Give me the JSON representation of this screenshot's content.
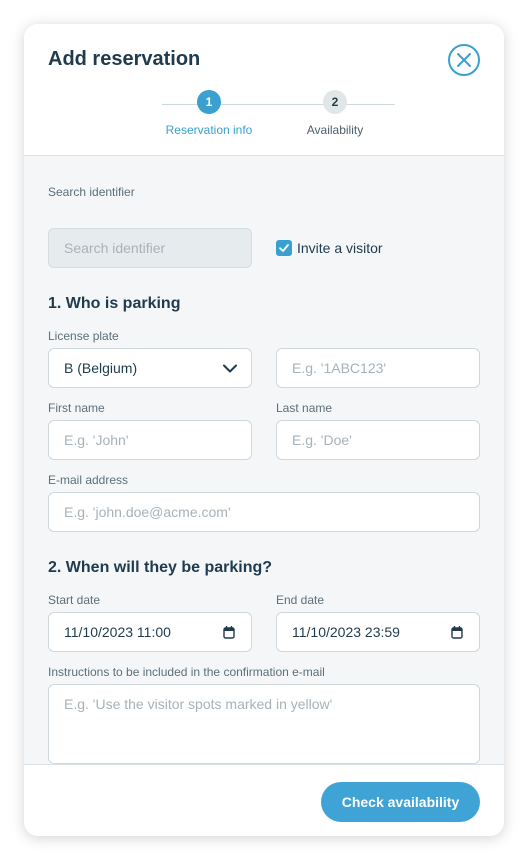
{
  "modal": {
    "title": "Add reservation"
  },
  "stepper": {
    "steps": [
      {
        "number": "1",
        "label": "Reservation info"
      },
      {
        "number": "2",
        "label": "Availability"
      }
    ]
  },
  "form": {
    "search_identifier": {
      "label": "Search identifier",
      "placeholder": "Search identifier",
      "value": ""
    },
    "invite_visitor": {
      "label": "Invite a visitor",
      "checked": true
    },
    "section_1_title": "1. Who is parking",
    "license_plate": {
      "label": "License plate",
      "country_selected": "B (Belgium)",
      "placeholder": "E.g. '1ABC123'"
    },
    "first_name": {
      "label": "First name",
      "placeholder": "E.g. 'John'"
    },
    "last_name": {
      "label": "Last name",
      "placeholder": "E.g. 'Doe'"
    },
    "email": {
      "label": "E-mail address",
      "placeholder": "E.g. 'john.doe@acme.com'"
    },
    "section_2_title": "2. When will they be parking?",
    "start_date": {
      "label": "Start date",
      "value": "11/10/2023 11:00"
    },
    "end_date": {
      "label": "End date",
      "value": "11/10/2023 23:59"
    },
    "instructions": {
      "label": "Instructions to be included in the confirmation e-mail",
      "placeholder": "E.g. 'Use the visitor spots marked in yellow'"
    }
  },
  "footer": {
    "check_label": "Check availability"
  },
  "colors": {
    "accent": "#3aa0cf",
    "text": "#1f3b4d",
    "background": "#f4f6f8"
  }
}
